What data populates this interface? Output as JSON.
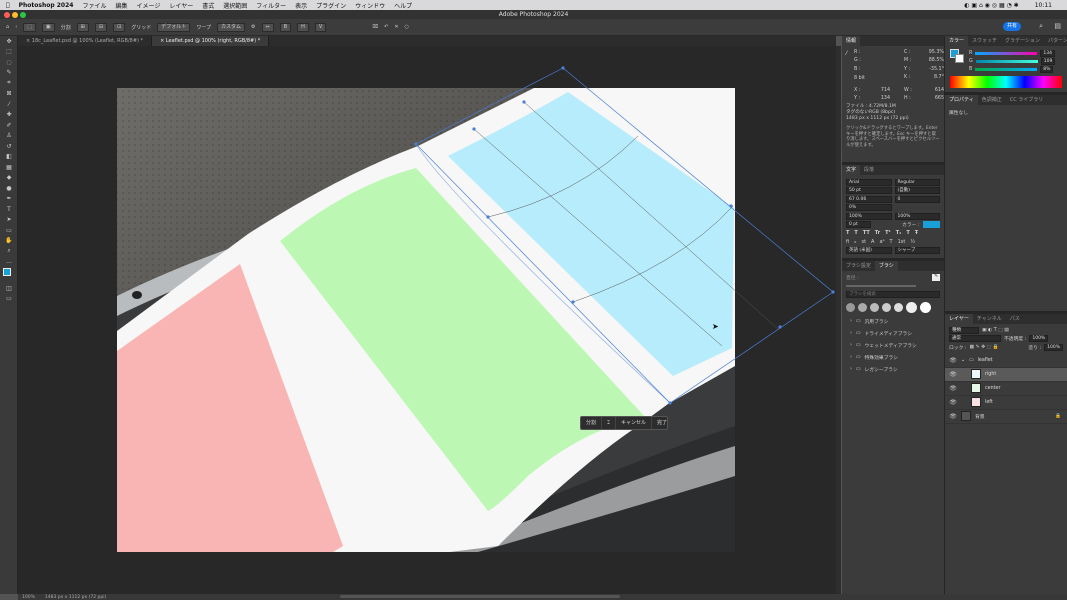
{
  "menubar": {
    "app": "Photoshop 2024",
    "items": [
      "ファイル",
      "編集",
      "イメージ",
      "レイヤー",
      "書式",
      "選択範囲",
      "フィルター",
      "表示",
      "プラグイン",
      "ウィンドウ",
      "ヘルプ"
    ],
    "clock": "10:11"
  },
  "window_title": "Adobe Photoshop 2024",
  "options_bar": {
    "split_label": "分割",
    "grid_label": "グリッド",
    "grid_value": "デフォルト",
    "warp_label": "ワープ",
    "warp_value": "カスタム",
    "share_label": "共有"
  },
  "tabs": [
    {
      "label": "18c_Leaflet.psd @ 100% (Leaflet, RGB/8#) *"
    },
    {
      "label": "Leaflet.psd @ 100% (right, RGB/8#) *"
    }
  ],
  "info_panel": {
    "tab": "情報",
    "r": "R :",
    "g": "G :",
    "b": "B :",
    "c": "C :",
    "c_val": "95.3%",
    "m": "M :",
    "m_val": "88.5%",
    "y": "Y :",
    "y_val": "-35.1°",
    "k": "K :",
    "k_val": "8.7°",
    "bits": "8 bit",
    "x": "X :",
    "x_val": "714",
    "yc": "Y :",
    "yc_val": "134",
    "w": "W :",
    "w_val": "614",
    "h": "H :",
    "h_val": "665",
    "file_line1": "ファイル : 4.72M/8.1M",
    "file_line2": "タグのないRGB (8bpc)",
    "file_line3": "1483 px x 1112 px (72 ppi)",
    "hint": "クリック&ドラッグするとワープします。Enter キーを押すと確定します。Esc キーを押すと取り消します。スペースバーを押すとピクセルツールが使えます。"
  },
  "char_panel": {
    "tabs": [
      "文字",
      "段落"
    ],
    "font": "Arial",
    "style": "Regular",
    "size": "50 pt",
    "leading": "(自動)",
    "kerning": "67 0.06",
    "tracking": "0",
    "scale_v": "0%",
    "scale_h_v": "100%",
    "scale_h": "100%",
    "baseline": "0 pt",
    "color_label": "カラー :",
    "lang": "英語 (米国)",
    "aa": "シャープ"
  },
  "brush_panel": {
    "tabs": [
      "ブラシ設定",
      "ブラシ"
    ],
    "size_label": "直径 :",
    "search_placeholder": "ブラシを検索",
    "folders": [
      "汎用ブラシ",
      "ドライメディアブラシ",
      "ウェットメディアブラシ",
      "特殊効果ブラシ",
      "レガシーブラシ"
    ]
  },
  "color_panel": {
    "tabs": [
      "カラー",
      "スウォッチ",
      "グラデーション",
      "パターン"
    ],
    "r": "R",
    "r_val": "134",
    "g": "G",
    "g_val": "109",
    "b": "B",
    "b_val": "8%"
  },
  "props_panel": {
    "tabs": [
      "プロパティ",
      "色調補正",
      "CC ライブラリ"
    ],
    "note": "属性なし"
  },
  "layers_panel": {
    "tabs": [
      "レイヤー",
      "チャンネル",
      "パス"
    ],
    "kind": "種類",
    "blend": "通常",
    "opacity_label": "不透明度 :",
    "opacity": "100%",
    "lock_label": "ロック :",
    "fill_label": "塗り :",
    "fill": "100%",
    "layers": [
      {
        "name": "leaflet",
        "kind": "folder"
      },
      {
        "name": "right",
        "kind": "layer",
        "selected": true
      },
      {
        "name": "center",
        "kind": "layer"
      },
      {
        "name": "left",
        "kind": "layer"
      },
      {
        "name": "背景",
        "kind": "layer"
      }
    ]
  },
  "transform_bar": {
    "items": [
      "分割",
      "",
      "キャンセル",
      "完了"
    ]
  },
  "status": {
    "zoom": "100%",
    "doc": "1483 px x 1112 px (72 ppi)"
  },
  "colors": {
    "accent": "#1473e6",
    "foreground": "#1aa0d8",
    "guide": "#4a7fd4",
    "pink": "#f9b5b4",
    "green": "#bdf7b4",
    "blue": "#b6ecfb"
  }
}
